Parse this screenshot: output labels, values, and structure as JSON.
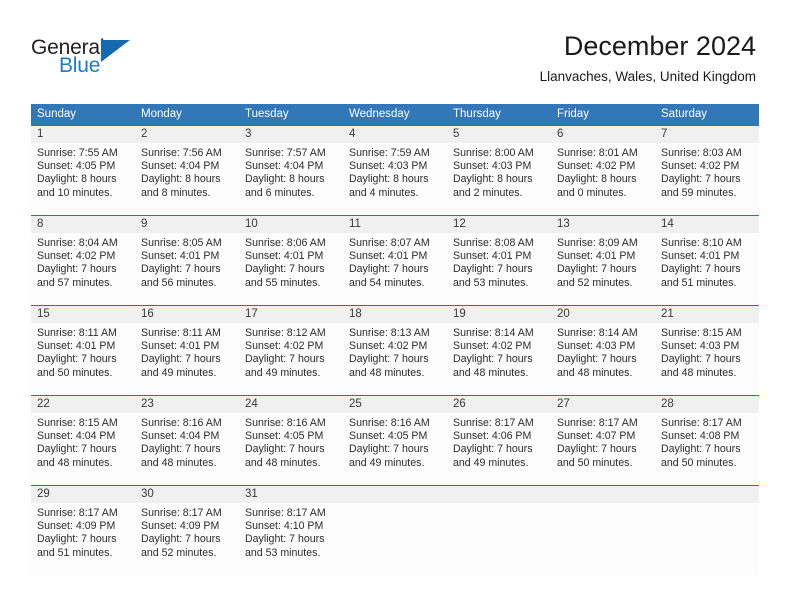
{
  "brand": {
    "name_part1": "General",
    "name_part2": "Blue",
    "color_dark": "#231f20",
    "color_blue": "#1e7bc4",
    "triangle_color": "#1569b0"
  },
  "header": {
    "title": "December 2024",
    "location": "Llanvaches, Wales, United Kingdom"
  },
  "theme": {
    "header_row_bg": "#3277b8",
    "header_row_text": "#ffffff",
    "week_divider": "#2f6fab",
    "day_number_bg": "#f0f0f0",
    "cell_bg": "#fdfdfd",
    "body_text": "#2b2b2b"
  },
  "weekdays": [
    "Sunday",
    "Monday",
    "Tuesday",
    "Wednesday",
    "Thursday",
    "Friday",
    "Saturday"
  ],
  "weeks": [
    {
      "days": [
        {
          "num": "1",
          "l1": "Sunrise: 7:55 AM",
          "l2": "Sunset: 4:05 PM",
          "l3": "Daylight: 8 hours",
          "l4": "and 10 minutes."
        },
        {
          "num": "2",
          "l1": "Sunrise: 7:56 AM",
          "l2": "Sunset: 4:04 PM",
          "l3": "Daylight: 8 hours",
          "l4": "and 8 minutes."
        },
        {
          "num": "3",
          "l1": "Sunrise: 7:57 AM",
          "l2": "Sunset: 4:04 PM",
          "l3": "Daylight: 8 hours",
          "l4": "and 6 minutes."
        },
        {
          "num": "4",
          "l1": "Sunrise: 7:59 AM",
          "l2": "Sunset: 4:03 PM",
          "l3": "Daylight: 8 hours",
          "l4": "and 4 minutes."
        },
        {
          "num": "5",
          "l1": "Sunrise: 8:00 AM",
          "l2": "Sunset: 4:03 PM",
          "l3": "Daylight: 8 hours",
          "l4": "and 2 minutes."
        },
        {
          "num": "6",
          "l1": "Sunrise: 8:01 AM",
          "l2": "Sunset: 4:02 PM",
          "l3": "Daylight: 8 hours",
          "l4": "and 0 minutes."
        },
        {
          "num": "7",
          "l1": "Sunrise: 8:03 AM",
          "l2": "Sunset: 4:02 PM",
          "l3": "Daylight: 7 hours",
          "l4": "and 59 minutes."
        }
      ]
    },
    {
      "days": [
        {
          "num": "8",
          "l1": "Sunrise: 8:04 AM",
          "l2": "Sunset: 4:02 PM",
          "l3": "Daylight: 7 hours",
          "l4": "and 57 minutes."
        },
        {
          "num": "9",
          "l1": "Sunrise: 8:05 AM",
          "l2": "Sunset: 4:01 PM",
          "l3": "Daylight: 7 hours",
          "l4": "and 56 minutes."
        },
        {
          "num": "10",
          "l1": "Sunrise: 8:06 AM",
          "l2": "Sunset: 4:01 PM",
          "l3": "Daylight: 7 hours",
          "l4": "and 55 minutes."
        },
        {
          "num": "11",
          "l1": "Sunrise: 8:07 AM",
          "l2": "Sunset: 4:01 PM",
          "l3": "Daylight: 7 hours",
          "l4": "and 54 minutes."
        },
        {
          "num": "12",
          "l1": "Sunrise: 8:08 AM",
          "l2": "Sunset: 4:01 PM",
          "l3": "Daylight: 7 hours",
          "l4": "and 53 minutes."
        },
        {
          "num": "13",
          "l1": "Sunrise: 8:09 AM",
          "l2": "Sunset: 4:01 PM",
          "l3": "Daylight: 7 hours",
          "l4": "and 52 minutes."
        },
        {
          "num": "14",
          "l1": "Sunrise: 8:10 AM",
          "l2": "Sunset: 4:01 PM",
          "l3": "Daylight: 7 hours",
          "l4": "and 51 minutes."
        }
      ]
    },
    {
      "days": [
        {
          "num": "15",
          "l1": "Sunrise: 8:11 AM",
          "l2": "Sunset: 4:01 PM",
          "l3": "Daylight: 7 hours",
          "l4": "and 50 minutes."
        },
        {
          "num": "16",
          "l1": "Sunrise: 8:11 AM",
          "l2": "Sunset: 4:01 PM",
          "l3": "Daylight: 7 hours",
          "l4": "and 49 minutes."
        },
        {
          "num": "17",
          "l1": "Sunrise: 8:12 AM",
          "l2": "Sunset: 4:02 PM",
          "l3": "Daylight: 7 hours",
          "l4": "and 49 minutes."
        },
        {
          "num": "18",
          "l1": "Sunrise: 8:13 AM",
          "l2": "Sunset: 4:02 PM",
          "l3": "Daylight: 7 hours",
          "l4": "and 48 minutes."
        },
        {
          "num": "19",
          "l1": "Sunrise: 8:14 AM",
          "l2": "Sunset: 4:02 PM",
          "l3": "Daylight: 7 hours",
          "l4": "and 48 minutes."
        },
        {
          "num": "20",
          "l1": "Sunrise: 8:14 AM",
          "l2": "Sunset: 4:03 PM",
          "l3": "Daylight: 7 hours",
          "l4": "and 48 minutes."
        },
        {
          "num": "21",
          "l1": "Sunrise: 8:15 AM",
          "l2": "Sunset: 4:03 PM",
          "l3": "Daylight: 7 hours",
          "l4": "and 48 minutes."
        }
      ]
    },
    {
      "days": [
        {
          "num": "22",
          "l1": "Sunrise: 8:15 AM",
          "l2": "Sunset: 4:04 PM",
          "l3": "Daylight: 7 hours",
          "l4": "and 48 minutes."
        },
        {
          "num": "23",
          "l1": "Sunrise: 8:16 AM",
          "l2": "Sunset: 4:04 PM",
          "l3": "Daylight: 7 hours",
          "l4": "and 48 minutes."
        },
        {
          "num": "24",
          "l1": "Sunrise: 8:16 AM",
          "l2": "Sunset: 4:05 PM",
          "l3": "Daylight: 7 hours",
          "l4": "and 48 minutes."
        },
        {
          "num": "25",
          "l1": "Sunrise: 8:16 AM",
          "l2": "Sunset: 4:05 PM",
          "l3": "Daylight: 7 hours",
          "l4": "and 49 minutes."
        },
        {
          "num": "26",
          "l1": "Sunrise: 8:17 AM",
          "l2": "Sunset: 4:06 PM",
          "l3": "Daylight: 7 hours",
          "l4": "and 49 minutes."
        },
        {
          "num": "27",
          "l1": "Sunrise: 8:17 AM",
          "l2": "Sunset: 4:07 PM",
          "l3": "Daylight: 7 hours",
          "l4": "and 50 minutes."
        },
        {
          "num": "28",
          "l1": "Sunrise: 8:17 AM",
          "l2": "Sunset: 4:08 PM",
          "l3": "Daylight: 7 hours",
          "l4": "and 50 minutes."
        }
      ]
    },
    {
      "days": [
        {
          "num": "29",
          "l1": "Sunrise: 8:17 AM",
          "l2": "Sunset: 4:09 PM",
          "l3": "Daylight: 7 hours",
          "l4": "and 51 minutes."
        },
        {
          "num": "30",
          "l1": "Sunrise: 8:17 AM",
          "l2": "Sunset: 4:09 PM",
          "l3": "Daylight: 7 hours",
          "l4": "and 52 minutes."
        },
        {
          "num": "31",
          "l1": "Sunrise: 8:17 AM",
          "l2": "Sunset: 4:10 PM",
          "l3": "Daylight: 7 hours",
          "l4": "and 53 minutes."
        },
        {
          "num": "",
          "l1": "",
          "l2": "",
          "l3": "",
          "l4": ""
        },
        {
          "num": "",
          "l1": "",
          "l2": "",
          "l3": "",
          "l4": ""
        },
        {
          "num": "",
          "l1": "",
          "l2": "",
          "l3": "",
          "l4": ""
        },
        {
          "num": "",
          "l1": "",
          "l2": "",
          "l3": "",
          "l4": ""
        }
      ]
    }
  ]
}
